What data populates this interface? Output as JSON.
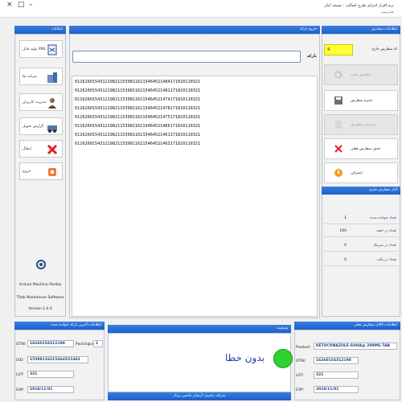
{
  "titlebar": {
    "title": "نرم افزار اجرای طرح اصالت - نسخه انبار",
    "subtitle": "مدیریت",
    "close": "×",
    "maximize": "□",
    "min": "–"
  },
  "left_panel": {
    "header": "امکانات",
    "buttons": [
      {
        "label": "تولید فایل XML",
        "icon": "xml-file-icon"
      },
      {
        "label": "شرکت ها",
        "icon": "companies-icon"
      },
      {
        "label": "مدیریت کاربران",
        "icon": "user-management-icon"
      },
      {
        "label": "گزارش تحویل",
        "icon": "delivery-report-icon"
      },
      {
        "label": "ابطال",
        "icon": "cancel-x-icon"
      },
      {
        "label": "خروج",
        "icon": "exit-icon"
      }
    ],
    "company": "Arshan Machine Pardaz",
    "software": "Titak Warehouse Software",
    "version": "Version 1.0.0"
  },
  "center_panel": {
    "header": "خروج بارکد",
    "search_label": "بارکد",
    "search_value": "",
    "rows": [
      "01162601543121982115398116215464521484171810110321",
      "01162601543121982115398116215464521481171810110321",
      "01162601543121982115398116215464521474171810110321",
      "01162601543121982115398116215464521478171810110321",
      "01162601543121982115398116215464521475171810110321",
      "01162601543121982115398116215464521466171810110321",
      "01162601543121982115398116215464521461171810110321",
      "01162601543121982115398116215464521463171810110321"
    ]
  },
  "right_panel": {
    "header": "اطلاعات سفارش",
    "order_label": "کد سفارش خارج",
    "order_value": "4",
    "buttons": [
      {
        "label": "سفارش جدید",
        "disabled": true
      },
      {
        "label": "ذخیره سفارش",
        "disabled": false
      },
      {
        "label": "ویرایش سفارش",
        "disabled": true
      },
      {
        "label": "حذف سفارش فعلی",
        "disabled": false
      },
      {
        "label": "انصراف",
        "disabled": false
      }
    ],
    "stats_header": "آمار سفارش جاری",
    "stats": [
      {
        "label": "تعداد خوانده شده",
        "value": "1"
      },
      {
        "label": "تعداد در جعبه",
        "value": "160"
      },
      {
        "label": "تعداد در شرینک",
        "value": "0"
      },
      {
        "label": "تعداد در پالت",
        "value": "0"
      }
    ]
  },
  "bottom_left": {
    "header": "اطلاعات آخرین بارکد خوانده شده",
    "gtin_label": "GTIN:",
    "gtin": "16260154312198",
    "packing_label": "PackingLevel:",
    "packing": "1",
    "uid_label": "UID:",
    "uid": "15398116215464521463",
    "lot_label": "LOT:",
    "lot": "321",
    "exp_label": "EXP:",
    "exp": "2018/11/01"
  },
  "bottom_center": {
    "header": "وضعیت",
    "status_text": "بدون خطا",
    "status_color": "#2ed12e",
    "footer": "شرکت مجری: آرشان ماشین پرداز"
  },
  "bottom_right": {
    "header": "اطلاعات کالای سفارش فعلی",
    "product_label": "Product:",
    "product": "KETOCONAZOLE-SOHA@ 200MG TAB",
    "gtin_label": "GTIN:",
    "gtin": "16260154312198",
    "lot_label": "LOT:",
    "lot": "321",
    "exp_label": "EXP:",
    "exp": "2018/11/01"
  }
}
